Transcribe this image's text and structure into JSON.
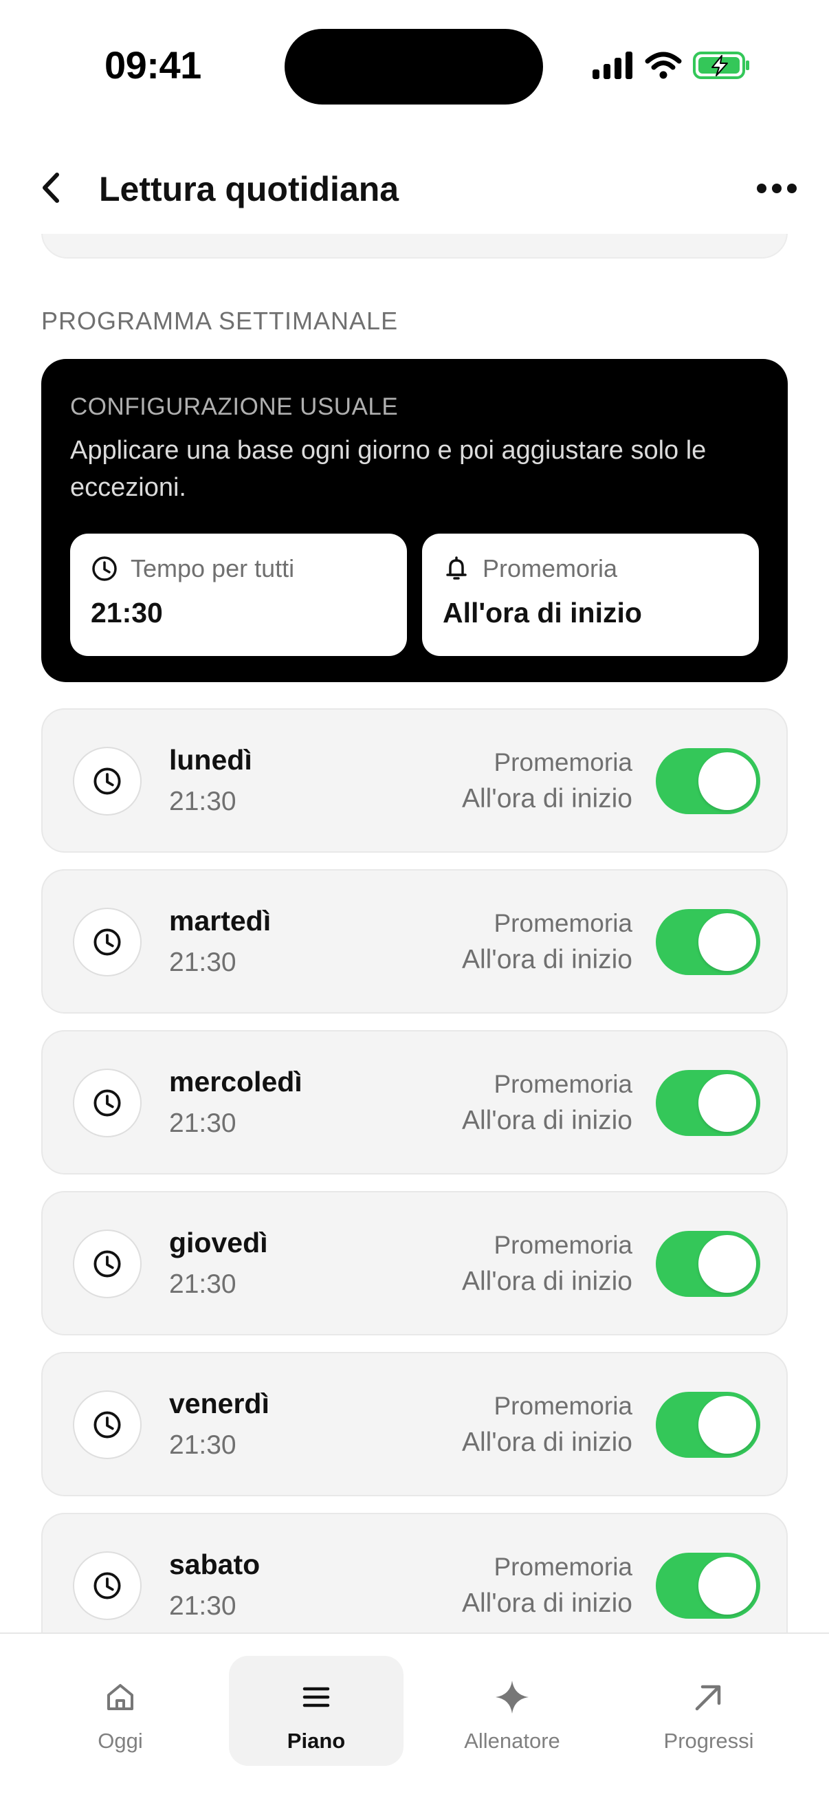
{
  "status_bar": {
    "time": "09:41"
  },
  "header": {
    "title": "Lettura quotidiana"
  },
  "section": {
    "title": "PROGRAMMA SETTIMANALE"
  },
  "config": {
    "label": "CONFIGURAZIONE USUALE",
    "description": "Applicare una base ogni giorno e poi aggiustare solo le eccezioni.",
    "time_tile": {
      "label": "Tempo per tutti",
      "value": "21:30"
    },
    "reminder_tile": {
      "label": "Promemoria",
      "value": "All'ora di inizio"
    }
  },
  "days": [
    {
      "name": "lunedì",
      "time": "21:30",
      "reminder_label": "Promemoria",
      "reminder_value": "All'ora di inizio",
      "enabled": true
    },
    {
      "name": "martedì",
      "time": "21:30",
      "reminder_label": "Promemoria",
      "reminder_value": "All'ora di inizio",
      "enabled": true
    },
    {
      "name": "mercoledì",
      "time": "21:30",
      "reminder_label": "Promemoria",
      "reminder_value": "All'ora di inizio",
      "enabled": true
    },
    {
      "name": "giovedì",
      "time": "21:30",
      "reminder_label": "Promemoria",
      "reminder_value": "All'ora di inizio",
      "enabled": true
    },
    {
      "name": "venerdì",
      "time": "21:30",
      "reminder_label": "Promemoria",
      "reminder_value": "All'ora di inizio",
      "enabled": true
    },
    {
      "name": "sabato",
      "time": "21:30",
      "reminder_label": "Promemoria",
      "reminder_value": "All'ora di inizio",
      "enabled": true
    }
  ],
  "tab_bar": {
    "tabs": [
      {
        "label": "Oggi",
        "icon": "home-icon",
        "active": false
      },
      {
        "label": "Piano",
        "icon": "menu-icon",
        "active": true
      },
      {
        "label": "Allenatore",
        "icon": "sparkle-icon",
        "active": false
      },
      {
        "label": "Progressi",
        "icon": "arrow-up-right-icon",
        "active": false
      }
    ]
  },
  "colors": {
    "toggle_on": "#34c759",
    "card_dark": "#000000",
    "row_bg": "#f4f4f4",
    "battery_green": "#34c759"
  }
}
